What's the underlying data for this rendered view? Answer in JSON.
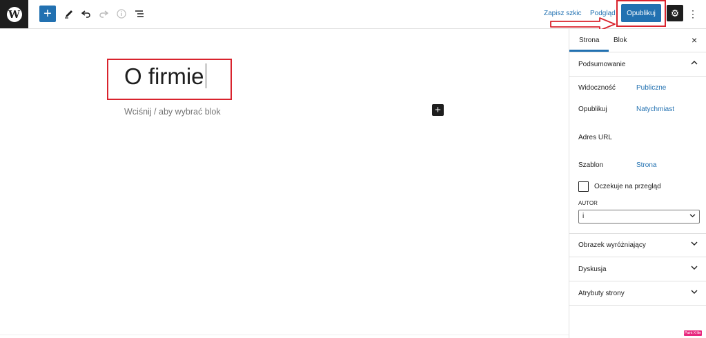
{
  "toolbar": {
    "logo_letter": "W",
    "add_icon": "plus-icon",
    "tools_icon": "pencil-icon",
    "undo_icon": "undo-icon",
    "redo_icon": "redo-icon",
    "info_icon": "info-icon",
    "list_icon": "list-view-icon",
    "save_draft": "Zapisz szkic",
    "preview": "Podgląd",
    "publish": "Opublikuj",
    "settings_icon": "gear-icon",
    "more_icon": "more-vertical-icon"
  },
  "editor": {
    "title": "O firmie",
    "placeholder": "Wciśnij / aby wybrać blok",
    "inserter": "+"
  },
  "sidebar": {
    "tabs": [
      "Strona",
      "Blok"
    ],
    "close": "×",
    "summary": {
      "heading": "Podsumowanie",
      "rows": [
        {
          "label": "Widoczność",
          "value": "Publiczne"
        },
        {
          "label": "Opublikuj",
          "value": "Natychmiast"
        },
        {
          "label": "Adres URL",
          "value": ""
        },
        {
          "label": "Szablon",
          "value": "Strona"
        }
      ],
      "pending_review": "Oczekuje na przegląd",
      "author_label": "AUTOR",
      "author_value": "i"
    },
    "panels": [
      "Obrazek wyróżniający",
      "Dyskusja",
      "Atrybuty strony"
    ]
  },
  "badge": "Paint X lite",
  "colors": {
    "accent": "#2271b1",
    "highlight": "#d9232d",
    "dark": "#1e1e1e"
  }
}
